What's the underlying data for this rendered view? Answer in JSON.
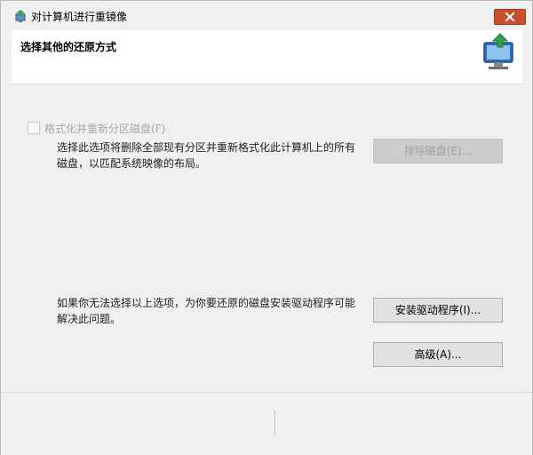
{
  "window": {
    "title": "对计算机进行重镜像",
    "close_icon": "close-icon"
  },
  "header": {
    "title": "选择其他的还原方式",
    "icon": "computer-restore-icon"
  },
  "format_option": {
    "checkbox_label": "格式化并重新分区磁盘(F)",
    "checked": false,
    "enabled": false,
    "description": "选择此选项将删除全部现有分区并重新格式化此计算机上的所有磁盘，以匹配系统映像的布局。",
    "exclude_button": "排除磁盘(E)..."
  },
  "driver_section": {
    "description": "如果你无法选择以上选项，为你要还原的磁盘安装驱动程序可能解决此问题。",
    "install_button": "安装驱动程序(I)...",
    "advanced_button": "高级(A)..."
  },
  "colors": {
    "close_button": "#c7502f",
    "window_bg": "#f0f0f0",
    "header_bg": "#ffffff"
  }
}
